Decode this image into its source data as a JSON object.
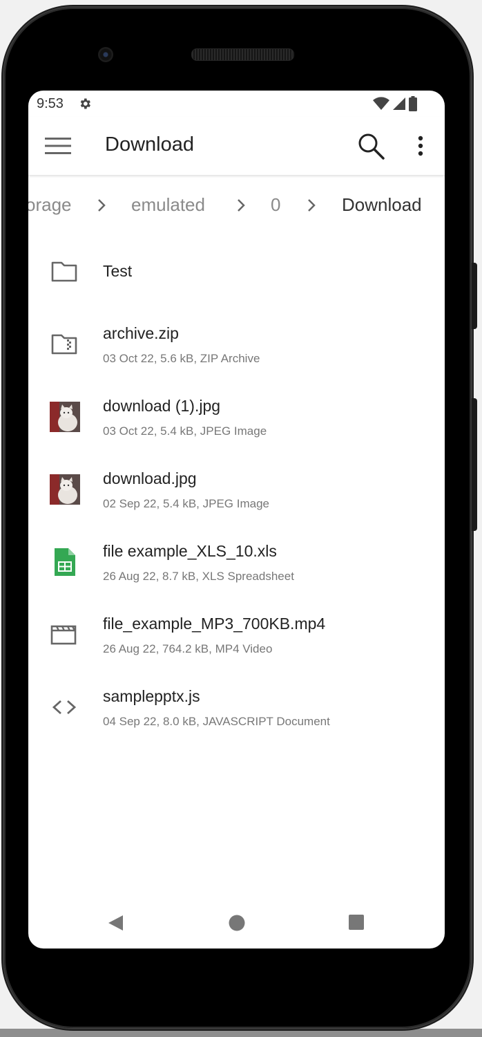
{
  "status": {
    "time": "9:53",
    "icons": [
      "settings-icon",
      "wifi-icon",
      "signal-icon",
      "battery-icon"
    ]
  },
  "appbar": {
    "title": "Download",
    "icons": [
      "menu-icon",
      "search-icon",
      "more-vert-icon"
    ]
  },
  "breadcrumb": [
    "orage",
    "emulated",
    "0",
    "Download"
  ],
  "files": [
    {
      "name": "Test",
      "meta": "",
      "icon": "folder-icon"
    },
    {
      "name": "archive.zip",
      "meta": "03 Oct 22, 5.6 kB, ZIP Archive",
      "icon": "zip-folder-icon"
    },
    {
      "name": "download (1).jpg",
      "meta": "03 Oct 22, 5.4 kB, JPEG Image",
      "icon": "cat-image-thumbnail"
    },
    {
      "name": "download.jpg",
      "meta": "02 Sep 22, 5.4 kB, JPEG Image",
      "icon": "cat-image-thumbnail"
    },
    {
      "name": "file example_XLS_10.xls",
      "meta": "26 Aug 22, 8.7 kB, XLS Spreadsheet",
      "icon": "spreadsheet-icon"
    },
    {
      "name": "file_example_MP3_700KB.mp4",
      "meta": "26 Aug 22, 764.2 kB, MP4 Video",
      "icon": "movie-icon"
    },
    {
      "name": "samplepptx.js",
      "meta": "04 Sep 22, 8.0 kB, JAVASCRIPT Document",
      "icon": "code-icon"
    }
  ],
  "navbar": {
    "icons": [
      "back-icon",
      "home-icon",
      "recents-icon"
    ]
  },
  "colors": {
    "spreadsheet_green": "#34a853",
    "icon_gray": "#666666",
    "text_dark": "#222222",
    "text_meta": "#777777"
  }
}
